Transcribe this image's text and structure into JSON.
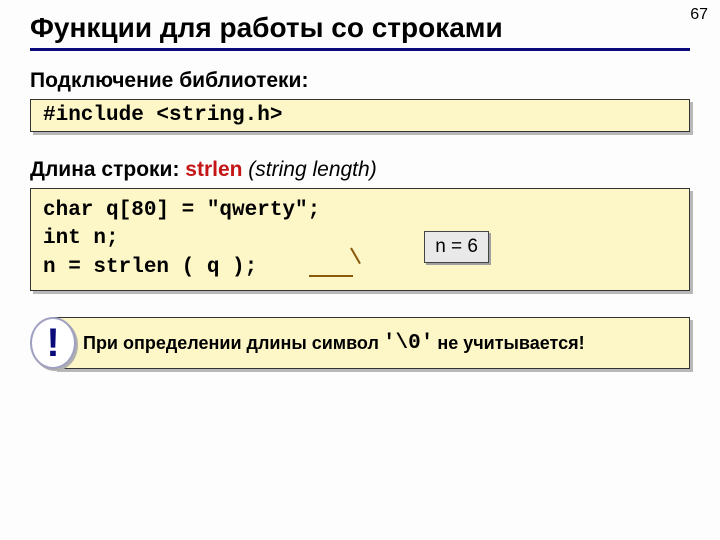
{
  "page_number": "67",
  "title": "Функции для работы со строками",
  "section1": {
    "label": "Подключение библиотеки:",
    "code": "#include <string.h>"
  },
  "section2": {
    "label_prefix": "Длина строки: ",
    "func": "strlen",
    "label_suffix": " (string length)",
    "code_line1": "char q[80] = \"qwerty\";",
    "code_line2": "int n;",
    "code_line3": "n = strlen ( q );",
    "badge": "n = 6"
  },
  "alert": {
    "bang": "!",
    "text_before": "При определении длины символ ",
    "nullchar": "'\\0'",
    "text_after": " не учитывается!"
  }
}
